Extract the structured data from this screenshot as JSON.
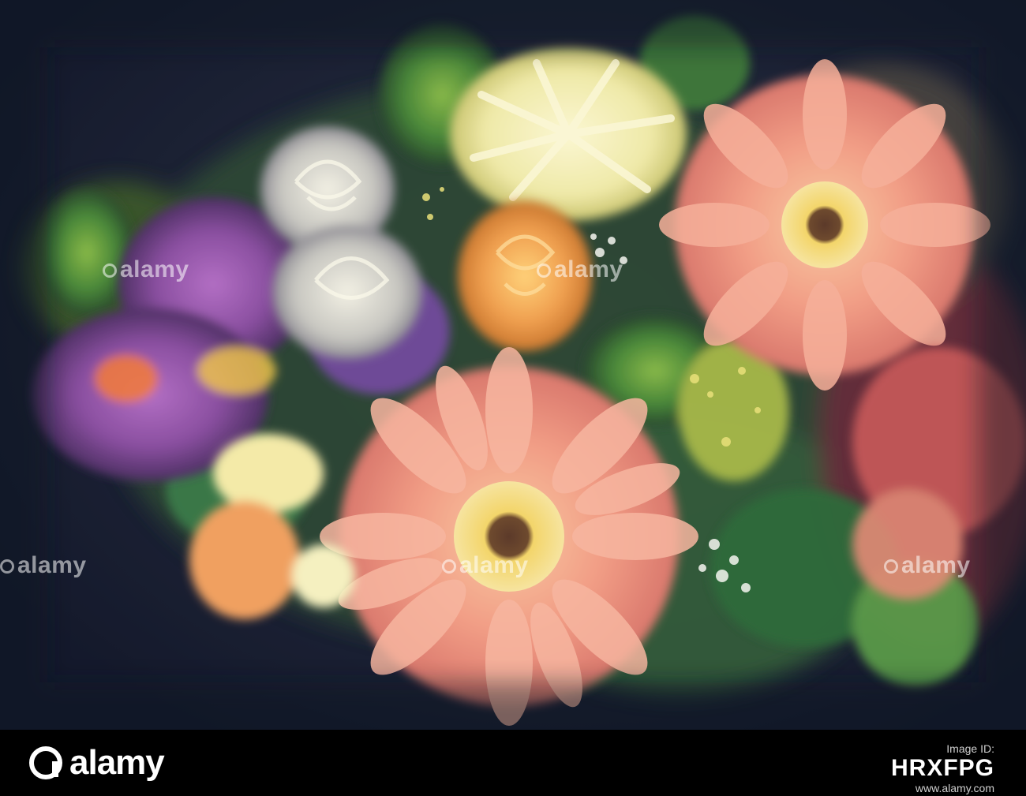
{
  "image": {
    "watermark_text": "alamy",
    "watermark_icon": "alamy-logo-icon"
  },
  "footer": {
    "logo_text": "alamy",
    "logo_icon": "alamy-logo-icon",
    "id_label": "Image ID:",
    "image_id": "HRXFPG",
    "url": "www.alamy.com"
  },
  "colors": {
    "background_dark": "#1b1f33",
    "peach_flower": "#f2a08a",
    "purple_flower": "#8a4fa0",
    "cream_flower": "#f3f0c8",
    "foliage_green": "#3f7a3a",
    "orange_rose": "#f0a050",
    "footer_bg": "#000000"
  }
}
